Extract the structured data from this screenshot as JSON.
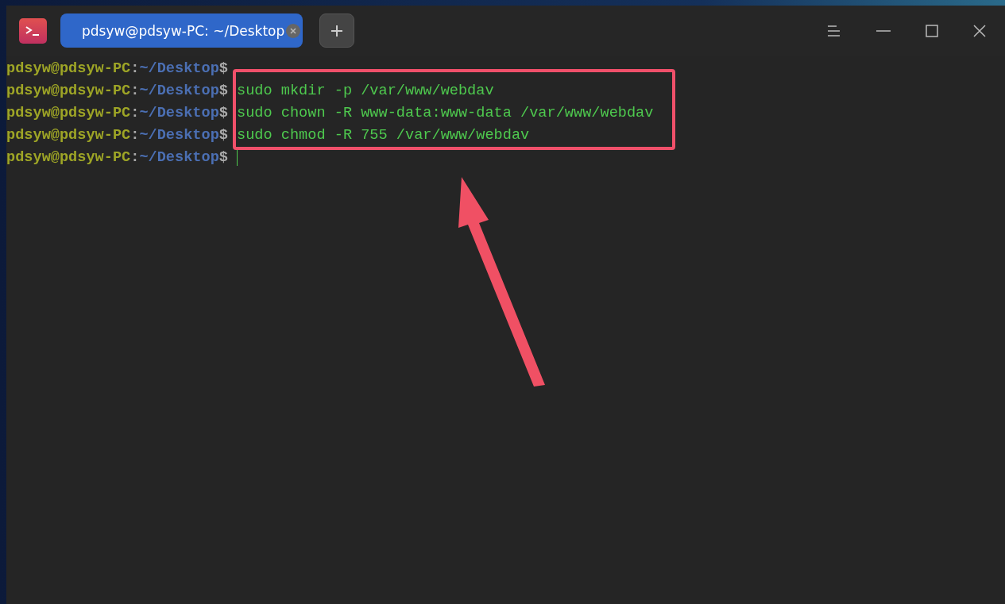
{
  "tabs": [
    {
      "label": "pdsyw@pdsyw-PC: ~/Desktop",
      "selected": true
    }
  ],
  "lines": [
    {
      "user": "pdsyw@pdsyw-PC",
      "separator": ":",
      "path": "~/Desktop",
      "symbol": "$",
      "cursor": false
    },
    {
      "user": "pdsyw@pdsyw-PC",
      "separator": ":",
      "path": "~/Desktop",
      "symbol": "$",
      "command": "sudo mkdir -p /var/www/webdav",
      "cursor": false
    },
    {
      "user": "pdsyw@pdsyw-PC",
      "separator": ":",
      "path": "~/Desktop",
      "symbol": "$",
      "command": "sudo chown -R www-data:www-data /var/www/webdav",
      "cursor": false
    },
    {
      "user": "pdsyw@pdsyw-PC",
      "separator": ":",
      "path": "~/Desktop",
      "symbol": "$",
      "command": "sudo chmod -R 755 /var/www/webdav",
      "cursor": false
    },
    {
      "user": "pdsyw@pdsyw-PC",
      "separator": ":",
      "path": "~/Desktop",
      "symbol": "$",
      "cursor": true
    }
  ]
}
